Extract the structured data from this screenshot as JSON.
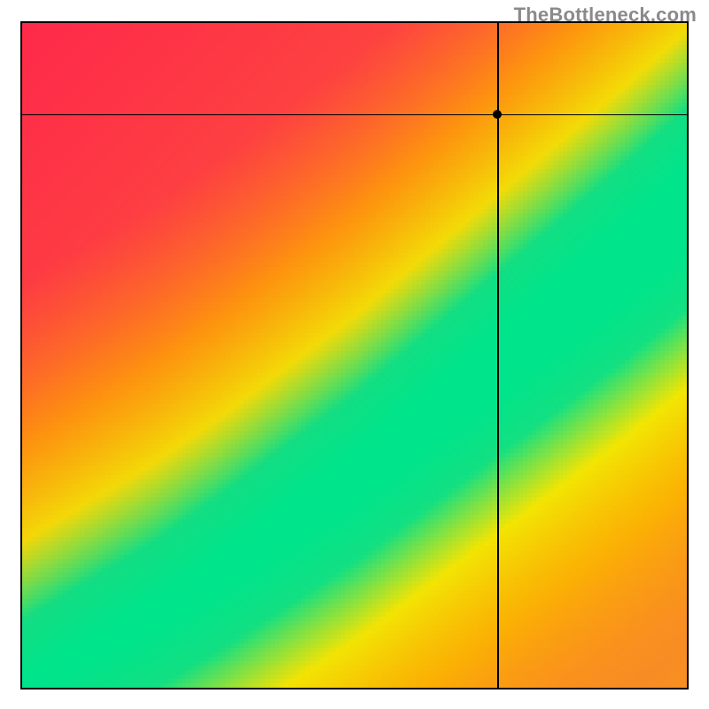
{
  "watermark": "TheBottleneck.com",
  "chart_data": {
    "type": "heatmap",
    "title": "",
    "xlabel": "",
    "ylabel": "",
    "x_range": [
      0,
      1
    ],
    "y_range": [
      0,
      1
    ],
    "crosshair": {
      "x": 0.715,
      "y": 0.863
    },
    "ideal_curve": [
      {
        "x": 0.0,
        "y": 0.0
      },
      {
        "x": 0.1,
        "y": 0.055
      },
      {
        "x": 0.2,
        "y": 0.11
      },
      {
        "x": 0.3,
        "y": 0.175
      },
      {
        "x": 0.4,
        "y": 0.245
      },
      {
        "x": 0.5,
        "y": 0.315
      },
      {
        "x": 0.6,
        "y": 0.395
      },
      {
        "x": 0.7,
        "y": 0.475
      },
      {
        "x": 0.8,
        "y": 0.555
      },
      {
        "x": 0.9,
        "y": 0.635
      },
      {
        "x": 1.0,
        "y": 0.72
      }
    ],
    "band_halfwidth_start": 0.01,
    "band_halfwidth_end": 0.06,
    "colors": {
      "optimal": "#00e58b",
      "near": "#f2ef00",
      "mid": "#ffa500",
      "far": "#ff2a4a"
    },
    "background_contrast": 0.52
  }
}
